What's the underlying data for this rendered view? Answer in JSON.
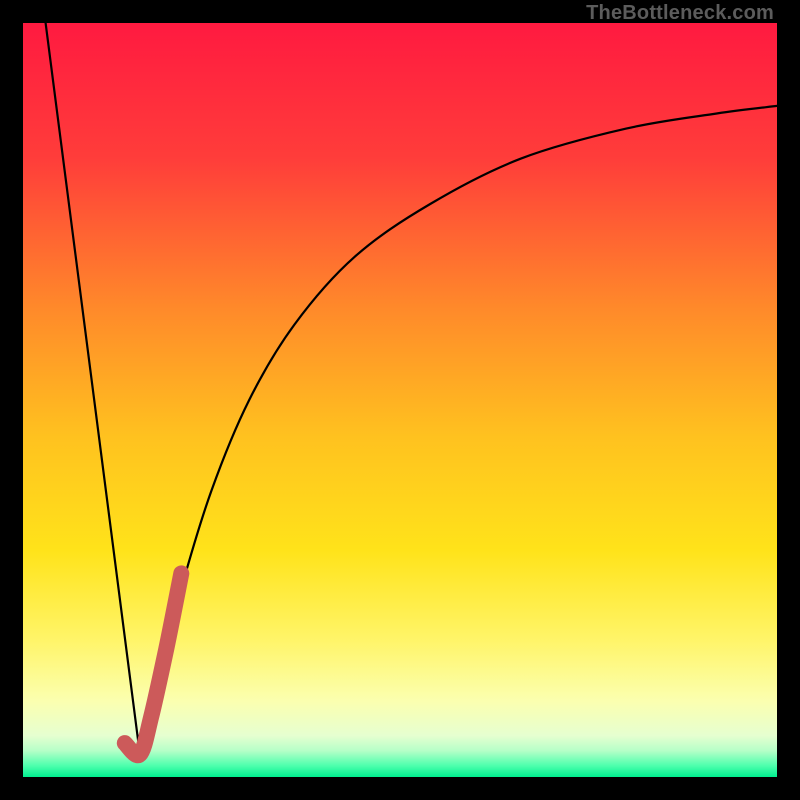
{
  "watermark": "TheBottleneck.com",
  "colors": {
    "frame": "#000000",
    "curve": "#000000",
    "highlight": "#cc5a5a",
    "gradient_stops": [
      {
        "offset": 0.0,
        "color": "#ff1a40"
      },
      {
        "offset": 0.18,
        "color": "#ff3d3a"
      },
      {
        "offset": 0.38,
        "color": "#ff8a2a"
      },
      {
        "offset": 0.55,
        "color": "#ffc21f"
      },
      {
        "offset": 0.7,
        "color": "#ffe31a"
      },
      {
        "offset": 0.82,
        "color": "#fff56a"
      },
      {
        "offset": 0.9,
        "color": "#fbffb0"
      },
      {
        "offset": 0.945,
        "color": "#e6ffd0"
      },
      {
        "offset": 0.965,
        "color": "#b6ffc8"
      },
      {
        "offset": 0.985,
        "color": "#4dffad"
      },
      {
        "offset": 1.0,
        "color": "#00ef8f"
      }
    ]
  },
  "chart_data": {
    "type": "line",
    "title": "",
    "xlabel": "",
    "ylabel": "",
    "xlim": [
      0,
      100
    ],
    "ylim": [
      0,
      100
    ],
    "series": [
      {
        "name": "v-curve-left",
        "x": [
          3,
          15.5
        ],
        "y": [
          100,
          3
        ]
      },
      {
        "name": "v-curve-right",
        "x": [
          15.5,
          18,
          21,
          25,
          30,
          36,
          44,
          54,
          66,
          80,
          92,
          100
        ],
        "y": [
          3,
          13,
          25,
          38,
          50,
          60,
          69,
          76,
          82,
          86,
          88,
          89
        ]
      },
      {
        "name": "highlight-segment",
        "x": [
          13.5,
          15.5,
          17,
          19,
          21
        ],
        "y": [
          4.5,
          3,
          8,
          17,
          27
        ]
      }
    ]
  }
}
